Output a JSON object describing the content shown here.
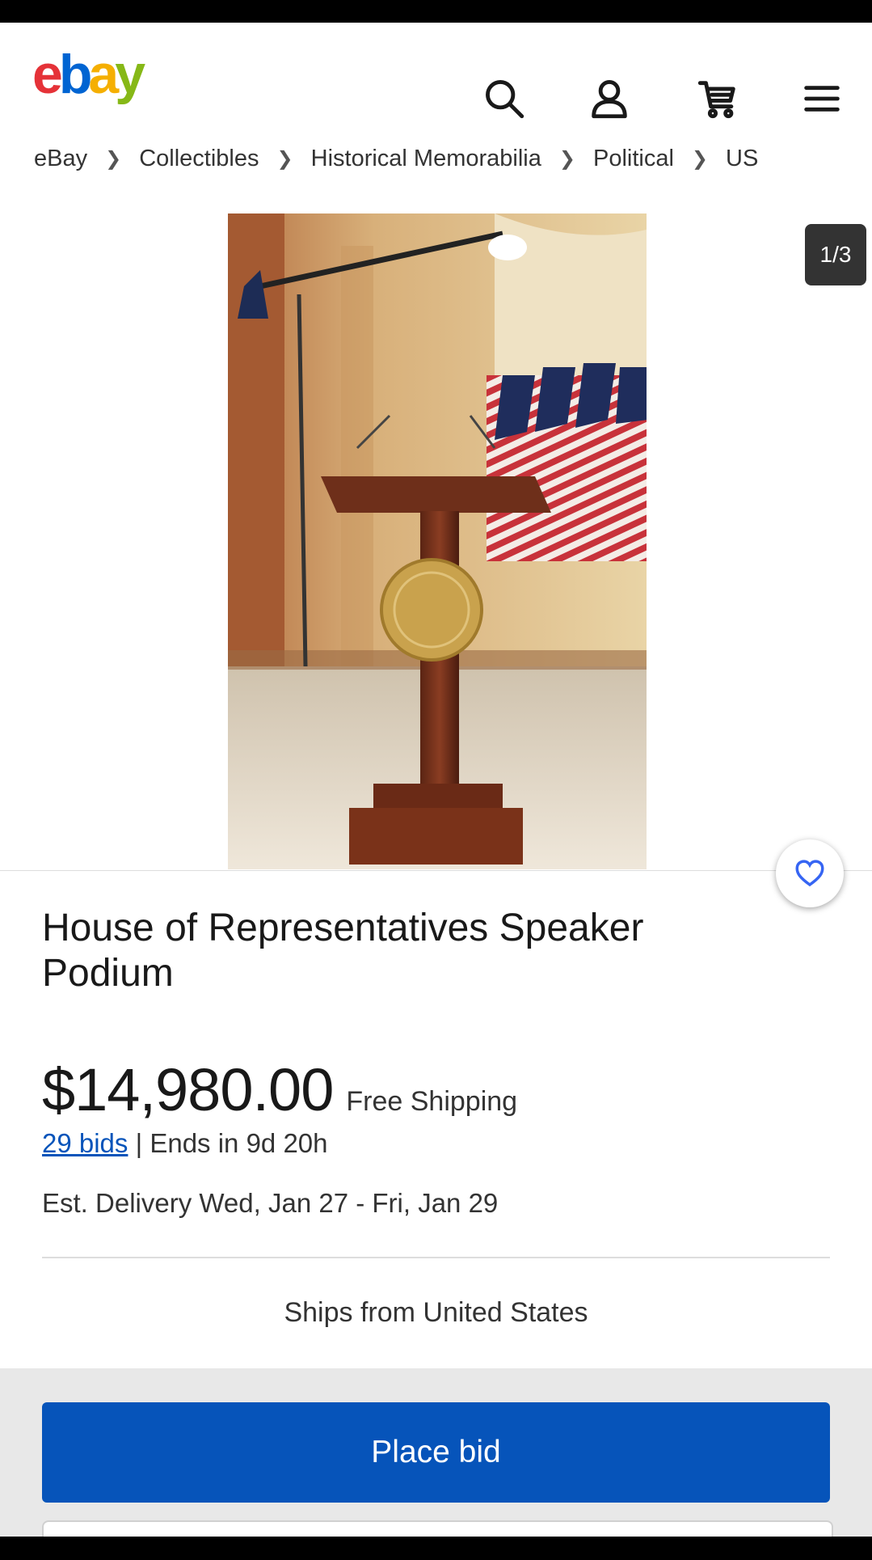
{
  "header": {
    "logo": {
      "e": "e",
      "b": "b",
      "a": "a",
      "y": "y"
    },
    "icons": [
      "search-icon",
      "user-icon",
      "cart-icon",
      "menu-icon"
    ]
  },
  "breadcrumb": [
    "eBay",
    "Collectibles",
    "Historical Memorabilia",
    "Political",
    "US"
  ],
  "gallery": {
    "counter": "1/3"
  },
  "listing": {
    "title": "House of Representatives Speaker Podium",
    "price": "$14,980.00",
    "shipping": "Free Shipping",
    "bids": "29 bids",
    "separator": "|",
    "ends": "Ends in 9d 20h",
    "delivery": "Est. Delivery Wed, Jan 27 - Fri, Jan 29",
    "ships_from": "Ships from United States"
  },
  "actions": {
    "place_bid": "Place bid"
  },
  "colors": {
    "brand_red": "#e53238",
    "brand_blue": "#0064d2",
    "brand_yellow": "#f5af02",
    "brand_green": "#86b817",
    "primary_button": "#0654ba",
    "link": "#0654ba"
  }
}
